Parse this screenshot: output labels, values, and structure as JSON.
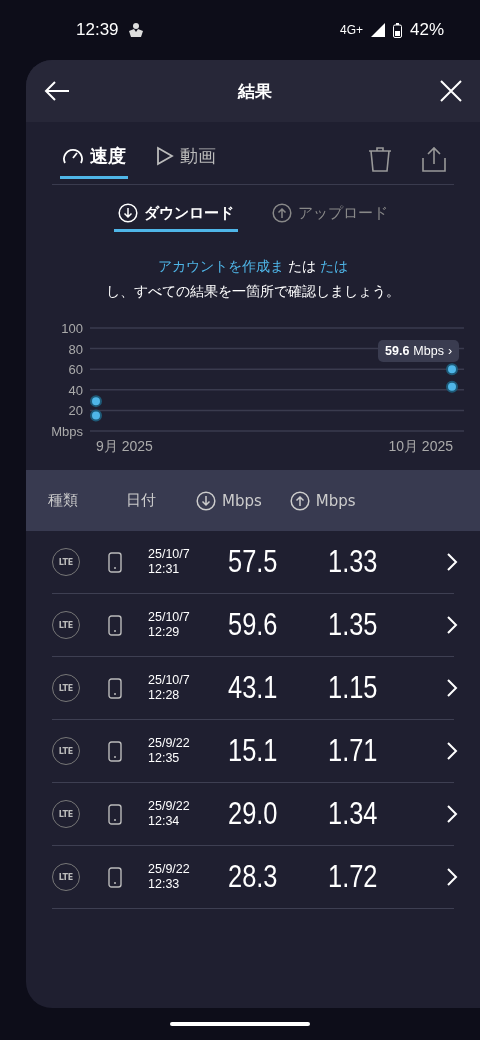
{
  "status_bar": {
    "time": "12:39",
    "network": "4G+",
    "battery": "42%"
  },
  "header": {
    "title": "結果"
  },
  "tabs": [
    {
      "label": "速度",
      "kind": "gauge",
      "selected": true
    },
    {
      "label": "動画",
      "kind": "play",
      "selected": false
    }
  ],
  "subtabs": [
    {
      "label": "ダウンロード",
      "kind": "down",
      "selected": true
    },
    {
      "label": "アップロード",
      "kind": "up",
      "selected": false
    }
  ],
  "promo": {
    "link": "アカウントを作成ま",
    "middle": "たは",
    "link2": "たは",
    "line2": "し、すべての結果を一箇所で確認しましょう。"
  },
  "chart": {
    "tooltip": {
      "value": "59.6",
      "unit": "Mbps",
      "arrow": "›"
    },
    "unit_label": "Mbps",
    "chart_data": {
      "type": "scatter",
      "grid": true,
      "ylim": [
        0,
        100
      ],
      "yticks": [
        20,
        40,
        60,
        80,
        100
      ],
      "categories": [
        "9月 2025",
        "10月 2025"
      ],
      "series": [
        {
          "color": "#4fb6e8",
          "values": [
            15,
            43
          ]
        },
        {
          "color": "#4fb6e8",
          "values": [
            29,
            60
          ]
        }
      ]
    }
  },
  "table": {
    "columns": [
      {
        "label": "種類",
        "kind": "text"
      },
      {
        "label": "日付",
        "kind": "text"
      },
      {
        "label": "Mbps",
        "kind": "down"
      },
      {
        "label": "Mbps",
        "kind": "up"
      }
    ],
    "rows": [
      {
        "type": "LTE",
        "date": "25/10/7",
        "time": "12:31",
        "down": "57.5",
        "up": "1.33"
      },
      {
        "type": "LTE",
        "date": "25/10/7",
        "time": "12:29",
        "down": "59.6",
        "up": "1.35"
      },
      {
        "type": "LTE",
        "date": "25/10/7",
        "time": "12:28",
        "down": "43.1",
        "up": "1.15"
      },
      {
        "type": "LTE",
        "date": "25/9/22",
        "time": "12:35",
        "down": "15.1",
        "up": "1.71"
      },
      {
        "type": "LTE",
        "date": "25/9/22",
        "time": "12:34",
        "down": "29.0",
        "up": "1.34"
      },
      {
        "type": "LTE",
        "date": "25/9/22",
        "time": "12:33",
        "down": "28.3",
        "up": "1.72"
      }
    ]
  }
}
